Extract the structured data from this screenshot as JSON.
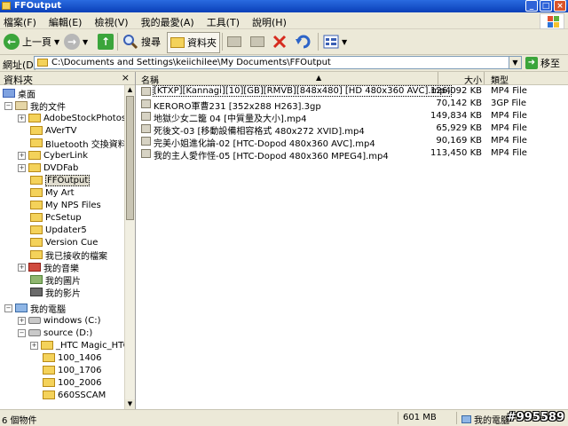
{
  "window": {
    "title": "FFOutput"
  },
  "menu": [
    "檔案(F)",
    "編輯(E)",
    "檢視(V)",
    "我的最愛(A)",
    "工具(T)",
    "說明(H)"
  ],
  "toolbar": {
    "back_label": "上一頁",
    "search_label": "搜尋",
    "folders_label": "資料夾"
  },
  "address": {
    "label": "網址(D)",
    "path": "C:\\Documents and Settings\\keiichilee\\My Documents\\FFOutput",
    "go_label": "移至"
  },
  "left_pane": {
    "title": "資料夾",
    "close": "×",
    "tree": [
      "桌面",
      "我的文件",
      "AdobeStockPhotos",
      "AVerTV",
      "Bluetooth 交換資料夾",
      "CyberLink",
      "DVDFab",
      "FFOutput",
      "My Art",
      "My NPS Files",
      "PcSetup",
      "Updater5",
      "Version Cue",
      "我已接收的檔案",
      "我的音樂",
      "我的圖片",
      "我的影片",
      "我的電腦",
      "windows (C:)",
      "source (D:)",
      "_HTC Magic_HTC",
      "100_1406",
      "100_1706",
      "100_2006",
      "660SSCAM"
    ]
  },
  "columns": {
    "name": "名稱",
    "size": "大小",
    "type": "類型"
  },
  "files": [
    {
      "name": "[KTXP][Kannagi][10][GB][RMVB][848x480] [HD 480x360 AVC].mp4",
      "size": "126,092 KB",
      "type": "MP4 File"
    },
    {
      "name": "KERORO軍曹231 [352x288 H263].3gp",
      "size": "70,142 KB",
      "type": "3GP File"
    },
    {
      "name": "地獄少女二籠 04 [中質量及大小].mp4",
      "size": "149,834 KB",
      "type": "MP4 File"
    },
    {
      "name": "死後文-03 [移動設備相容格式 480x272 XVID].mp4",
      "size": "65,929 KB",
      "type": "MP4 File"
    },
    {
      "name": "完美小姐進化論-02 [HTC-Dopod 480x360 AVC].mp4",
      "size": "90,169 KB",
      "type": "MP4 File"
    },
    {
      "name": "我的主人愛作怪-05 [HTC-Dopod 480x360 MPEG4].mp4",
      "size": "113,450 KB",
      "type": "MP4 File"
    }
  ],
  "status": {
    "count": "6 個物件",
    "total": "601 MB",
    "location": "我的電腦",
    "watermark": "#995589"
  },
  "colors": {
    "title_blue": "#0A3FB8",
    "chrome": "#ECE9D8",
    "folder": "#F4D25A"
  }
}
